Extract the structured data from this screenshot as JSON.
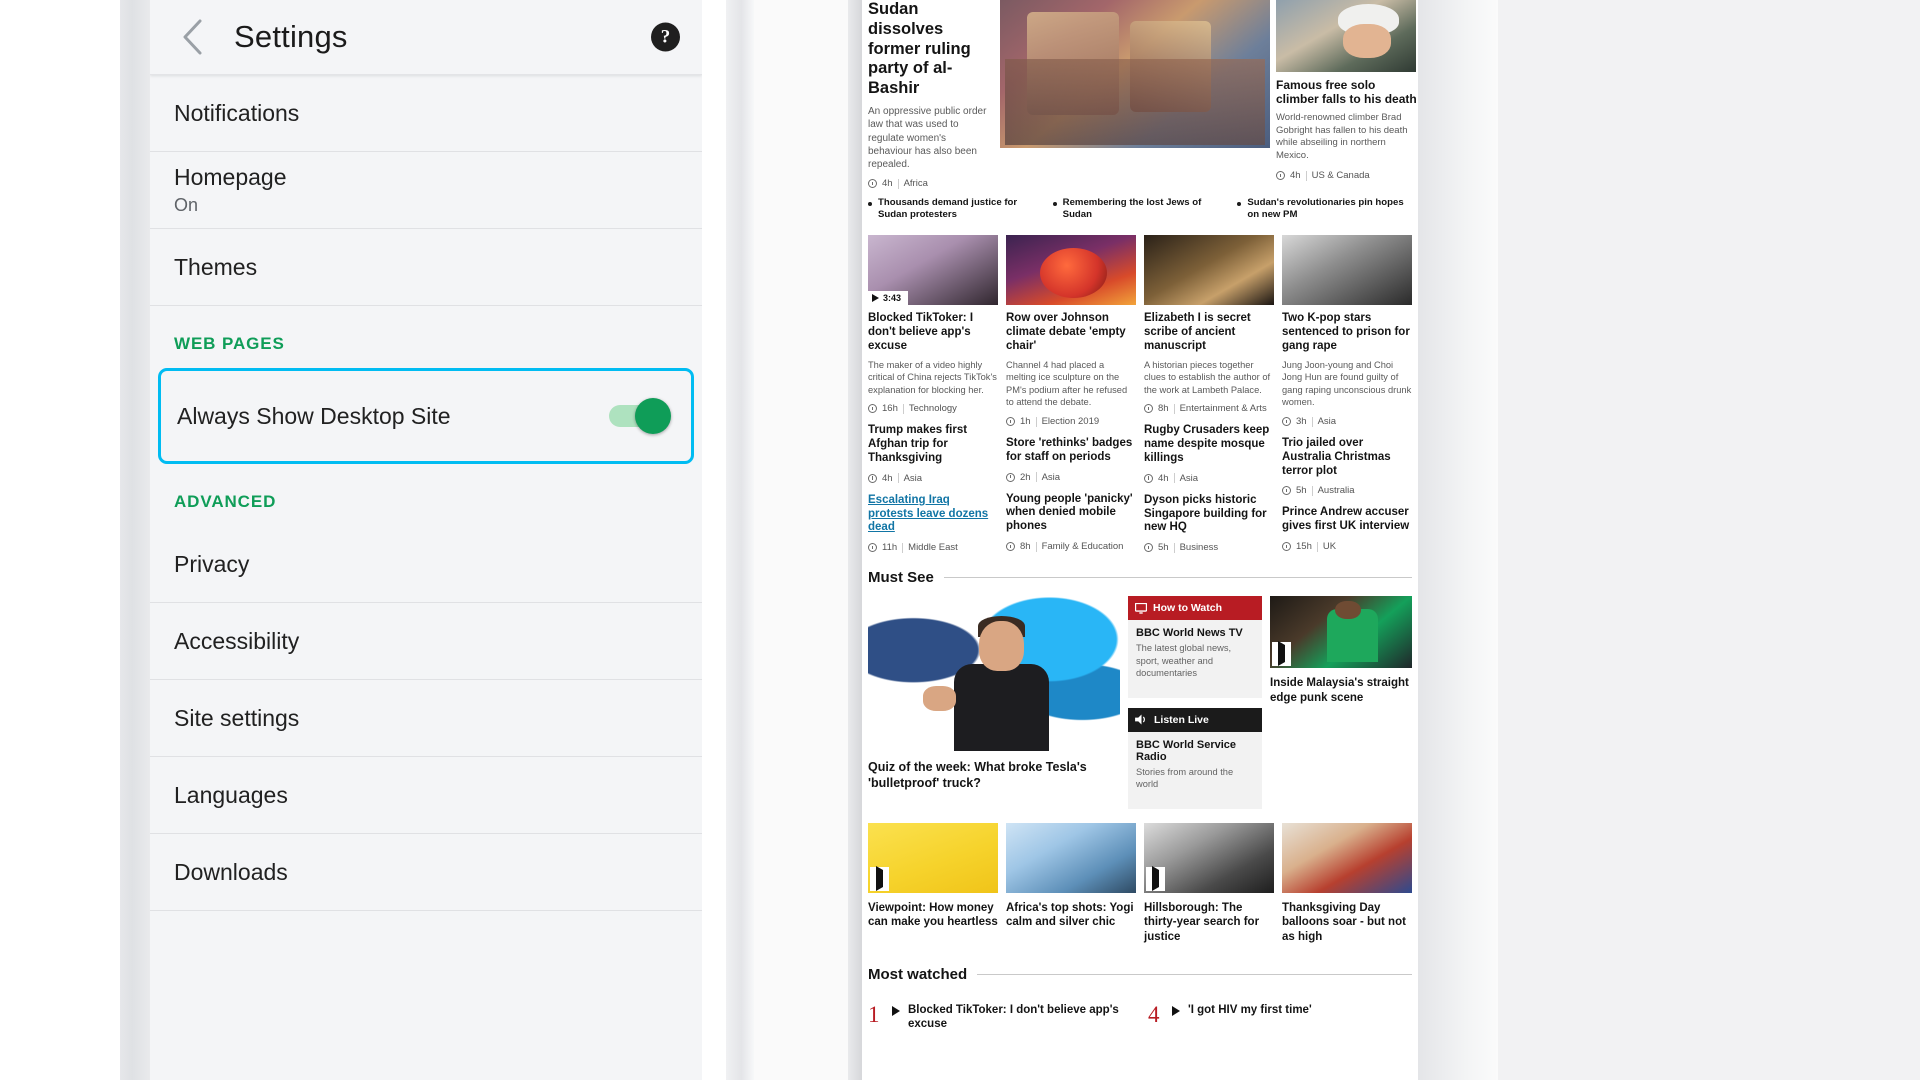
{
  "settings": {
    "title": "Settings",
    "back_icon": "chevron-left-icon",
    "help_icon": "?",
    "items": [
      {
        "label": "Notifications",
        "sub": ""
      },
      {
        "label": "Homepage",
        "sub": "On"
      },
      {
        "label": "Themes",
        "sub": ""
      }
    ],
    "section_web_pages": "WEB PAGES",
    "desktop_site": {
      "label": "Always Show Desktop Site",
      "state": "on"
    },
    "section_advanced": "ADVANCED",
    "advanced_items": [
      {
        "label": "Privacy"
      },
      {
        "label": "Accessibility"
      },
      {
        "label": "Site settings"
      },
      {
        "label": "Languages"
      },
      {
        "label": "Downloads"
      }
    ],
    "accent_green": "#0f9d58",
    "highlight_cyan": "#00bcf2"
  },
  "bbc": {
    "hero": {
      "headline": "Sudan dissolves former ruling party of al-Bashir",
      "summary": "An oppressive public order law that was used to regulate women's behaviour has also been repealed.",
      "time": "4h",
      "category": "Africa"
    },
    "hero_side": {
      "headline": "Famous free solo climber falls to his death",
      "summary": "World-renowned climber Brad Gobright has fallen to his death while abseiling in northern Mexico.",
      "time": "4h",
      "category": "US & Canada"
    },
    "bullets": [
      "Thousands demand justice for Sudan protesters",
      "Remembering the lost Jews of Sudan",
      "Sudan's revolutionaries pin hopes on new PM"
    ],
    "grid": [
      {
        "duration": "3:43",
        "headline": "Blocked TikToker: I don't believe app's excuse",
        "summary": "The maker of a video highly critical of China rejects TikTok's explanation for blocking her.",
        "time": "16h",
        "category": "Technology",
        "link2": "Trump makes first Afghan trip for Thanksgiving",
        "time2": "4h",
        "cat2": "Asia",
        "link3": "Escalating Iraq protests leave dozens dead",
        "time3": "11h",
        "cat3": "Middle East",
        "link3_is_link": true
      },
      {
        "duration": "",
        "headline": "Row over Johnson climate debate 'empty chair'",
        "summary": "Channel 4 had placed a melting ice sculpture on the PM's podium after he refused to attend the debate.",
        "time": "1h",
        "category": "Election 2019",
        "link2": "Store 'rethinks' badges for staff on periods",
        "time2": "2h",
        "cat2": "Asia",
        "link3": "Young people 'panicky' when denied mobile phones",
        "time3": "8h",
        "cat3": "Family & Education",
        "link3_is_link": false
      },
      {
        "duration": "",
        "headline": "Elizabeth I is secret scribe of ancient manuscript",
        "summary": "A historian pieces together clues to establish the author of the work at Lambeth Palace.",
        "time": "8h",
        "category": "Entertainment & Arts",
        "link2": "Rugby Crusaders keep name despite mosque killings",
        "time2": "4h",
        "cat2": "Asia",
        "link3": "Dyson picks historic Singapore building for new HQ",
        "time3": "5h",
        "cat3": "Business",
        "link3_is_link": false
      },
      {
        "duration": "",
        "headline": "Two K-pop stars sentenced to prison for gang rape",
        "summary": "Jung Joon-young and Choi Jong Hun are found guilty of gang raping unconscious drunk women.",
        "time": "3h",
        "category": "Asia",
        "link2": "Trio jailed over Australia Christmas terror plot",
        "time2": "5h",
        "cat2": "Australia",
        "link3": "Prince Andrew accuser gives first UK interview",
        "time3": "15h",
        "cat3": "UK",
        "link3_is_link": false
      }
    ],
    "must_see": {
      "title": "Must See",
      "big_caption": "Quiz of the week: What broke Tesla's 'bulletproof' truck?",
      "how_to_watch": {
        "banner": "How to Watch",
        "icon": "tv-icon",
        "title": "BBC World News TV",
        "desc": "The latest global news, sport, weather and documentaries"
      },
      "listen_live": {
        "banner": "Listen Live",
        "icon": "speaker-icon",
        "title": "BBC World Service Radio",
        "desc": "Stories from around the world"
      },
      "right_caption": "Inside Malaysia's straight edge punk scene"
    },
    "bottom_thumbs": [
      {
        "caption": "Viewpoint: How money can make you heartless"
      },
      {
        "caption": "Africa's top shots: Yogi calm and silver chic"
      },
      {
        "caption": "Hillsborough: The thirty-year search for justice"
      },
      {
        "caption": "Thanksgiving Day balloons soar - but not as high"
      }
    ],
    "most_watched": {
      "title": "Most watched",
      "items": [
        {
          "rank": "1",
          "title": "Blocked TikToker: I don't believe app's excuse"
        },
        {
          "rank": "4",
          "title": "'I got HIV my first time'"
        }
      ]
    }
  }
}
